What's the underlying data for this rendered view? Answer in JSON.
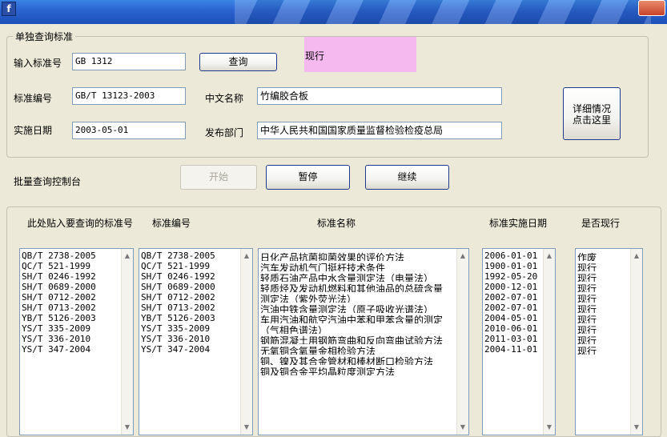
{
  "titlebar": {
    "icon_glyph": "f"
  },
  "single_query": {
    "group_title": "单独查询标准",
    "input_label": "输入标准号",
    "input_value": "GB 1312",
    "query_button": "查询",
    "status_text": "现行",
    "std_no_label": "标准编号",
    "std_no_value": "GB/T 13123-2003",
    "cn_name_label": "中文名称",
    "cn_name_value": "竹编胶合板",
    "date_label": "实施日期",
    "date_value": "2003-05-01",
    "dept_label": "发布部门",
    "dept_value": "中华人民共和国国家质量监督检验检疫总局",
    "detail_button_line1": "详细情况",
    "detail_button_line2": "点击这里"
  },
  "batch": {
    "console_label": "批量查询控制台",
    "start_button": "开始",
    "pause_button": "暂停",
    "continue_button": "继续"
  },
  "columns": {
    "paste_header": "此处贴入要查询的标准号",
    "std_no_header": "标准编号",
    "name_header": "标准名称",
    "date_header": "标准实施日期",
    "current_header": "是否现行"
  },
  "lists": {
    "input_numbers": [
      "QB/T 2738-2005",
      "QC/T 521-1999",
      "SH/T 0246-1992",
      "SH/T 0689-2000",
      "SH/T 0712-2002",
      "SH/T 0713-2002",
      "YB/T 5126-2003",
      "YS/T 335-2009",
      "YS/T 336-2010",
      "YS/T 347-2004"
    ],
    "std_numbers": [
      "QB/T 2738-2005",
      "QC/T 521-1999",
      "SH/T 0246-1992",
      "SH/T 0689-2000",
      "SH/T 0712-2002",
      "SH/T 0713-2002",
      "YB/T 5126-2003",
      "YS/T 335-2009",
      "YS/T 336-2010",
      "YS/T 347-2004"
    ],
    "std_names": [
      "日化产品抗菌抑菌效果的评价方法",
      "汽车发动机气门挺杆技术条件",
      "轻质石油产品中水含量测定法（电量法）",
      "轻质烃及发动机燃料和其他油品的总硫含量",
      "测定法（紫外荧光法）",
      "汽油中铁含量测定法（原子吸收光谱法）",
      "车用汽油和航空汽油中苯和甲苯含量的测定",
      "（气相色谱法）",
      "钢筋混凝土用钢筋弯曲和反向弯曲试验方法",
      "无氧铜含氧量金相检验方法",
      "铜、镍及其合金管材和棒材断口检验方法",
      "铜及铜合金平均晶粒度测定方法"
    ],
    "dates": [
      "2006-01-01",
      "1900-01-01",
      "1992-05-20",
      "2000-12-01",
      "2002-07-01",
      "2002-07-01",
      "2004-05-01",
      "2010-06-01",
      "2011-03-01",
      "2004-11-01"
    ],
    "current_status": [
      "作废",
      "现行",
      "现行",
      "现行",
      "现行",
      "现行",
      "现行",
      "现行",
      "现行",
      "现行"
    ]
  },
  "colors": {
    "status_bg": "#f5b9f0",
    "window_bg": "#ece9d8"
  }
}
